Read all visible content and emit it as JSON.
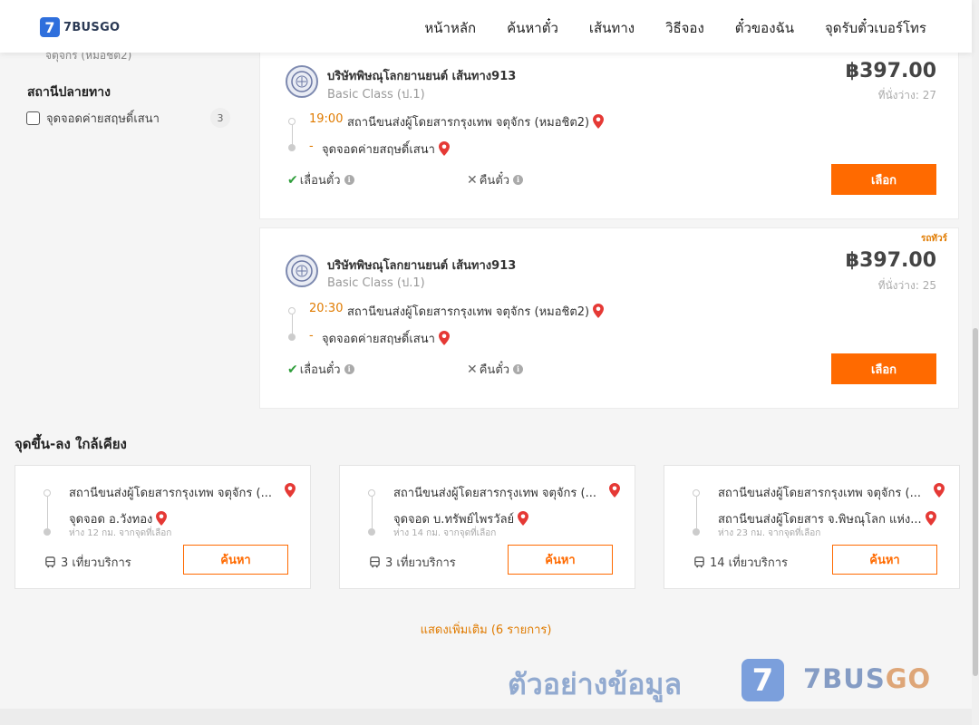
{
  "header": {
    "logo_icon": "7",
    "logo_text": "7BUSGO",
    "nav": [
      "หน้าหลัก",
      "ค้นหาตั๋ว",
      "เส้นทาง",
      "วิธีจอง",
      "ตั๋วของฉัน",
      "จุดรับตั๋วเบอร์โทร"
    ]
  },
  "filter": {
    "cut_text": "จตุจักร (หมอชิต2)",
    "arrival_title": "สถานีปลายทาง",
    "arrival_option": {
      "label": "จุดจอดค่ายสฤษดิ์เสนา",
      "count": "3"
    }
  },
  "trips": [
    {
      "operator": "บริษัทพิษณุโลกยานยนต์ เส้นทาง913",
      "class": "Basic Class (ป.1)",
      "price": "฿397.00",
      "seats": "ที่นั่งว่าง: 27",
      "dep_time": "19:00",
      "dep_stop": "สถานีขนส่งผู้โดยสารกรุงเทพ จตุจักร (หมอชิต2)",
      "arr_dash": "-",
      "arr_stop": "จุดจอดค่ายสฤษดิ์เสนา",
      "reschedule": "เลื่อนตั๋ว",
      "refund": "คืนตั๋ว",
      "select": "เลือก",
      "badge": ""
    },
    {
      "operator": "บริษัทพิษณุโลกยานยนต์ เส้นทาง913",
      "class": "Basic Class (ป.1)",
      "price": "฿397.00",
      "seats": "ที่นั่งว่าง: 25",
      "dep_time": "20:30",
      "dep_stop": "สถานีขนส่งผู้โดยสารกรุงเทพ จตุจักร (หมอชิต2)",
      "arr_dash": "-",
      "arr_stop": "จุดจอดค่ายสฤษดิ์เสนา",
      "reschedule": "เลื่อนตั๋ว",
      "refund": "คืนตั๋ว",
      "select": "เลือก",
      "badge": "รถทัวร์"
    }
  ],
  "nearby": {
    "title": "จุดขึ้น-ลง ใกล้เคียง",
    "cards": [
      {
        "from": "สถานีขนส่งผู้โดยสารกรุงเทพ จตุจักร (...",
        "to": "จุดจอด อ.วังทอง",
        "distance": "ห่าง 12 กม. จากจุดที่เลือก",
        "trips": "3 เที่ยวบริการ",
        "button": "ค้นหา"
      },
      {
        "from": "สถานีขนส่งผู้โดยสารกรุงเทพ จตุจักร (...",
        "to": "จุดจอด บ.ทรัพย์ไพรวัลย์",
        "distance": "ห่าง 14 กม. จากจุดที่เลือก",
        "trips": "3 เที่ยวบริการ",
        "button": "ค้นหา"
      },
      {
        "from": "สถานีขนส่งผู้โดยสารกรุงเทพ จตุจักร (...",
        "to": "สถานีขนส่งผู้โดยสาร จ.พิษณุโลก แห่ง...",
        "distance": "ห่าง 23 กม. จากจุดที่เลือก",
        "trips": "14 เที่ยวบริการ",
        "button": "ค้นหา"
      }
    ],
    "show_more": "แสดงเพิ่มเติม (6 รายการ)"
  },
  "watermark": {
    "text": "ตัวอย่างข้อมูล",
    "logo_icon": "7",
    "brand_a": "7BUS",
    "brand_b": "GO"
  },
  "colors": {
    "accent": "#ff6a00",
    "time": "#e07b00",
    "brand": "#2f6fdc"
  },
  "icons": [
    "location-pin-icon",
    "check-icon",
    "cross-icon",
    "info-icon",
    "bus-icon"
  ]
}
